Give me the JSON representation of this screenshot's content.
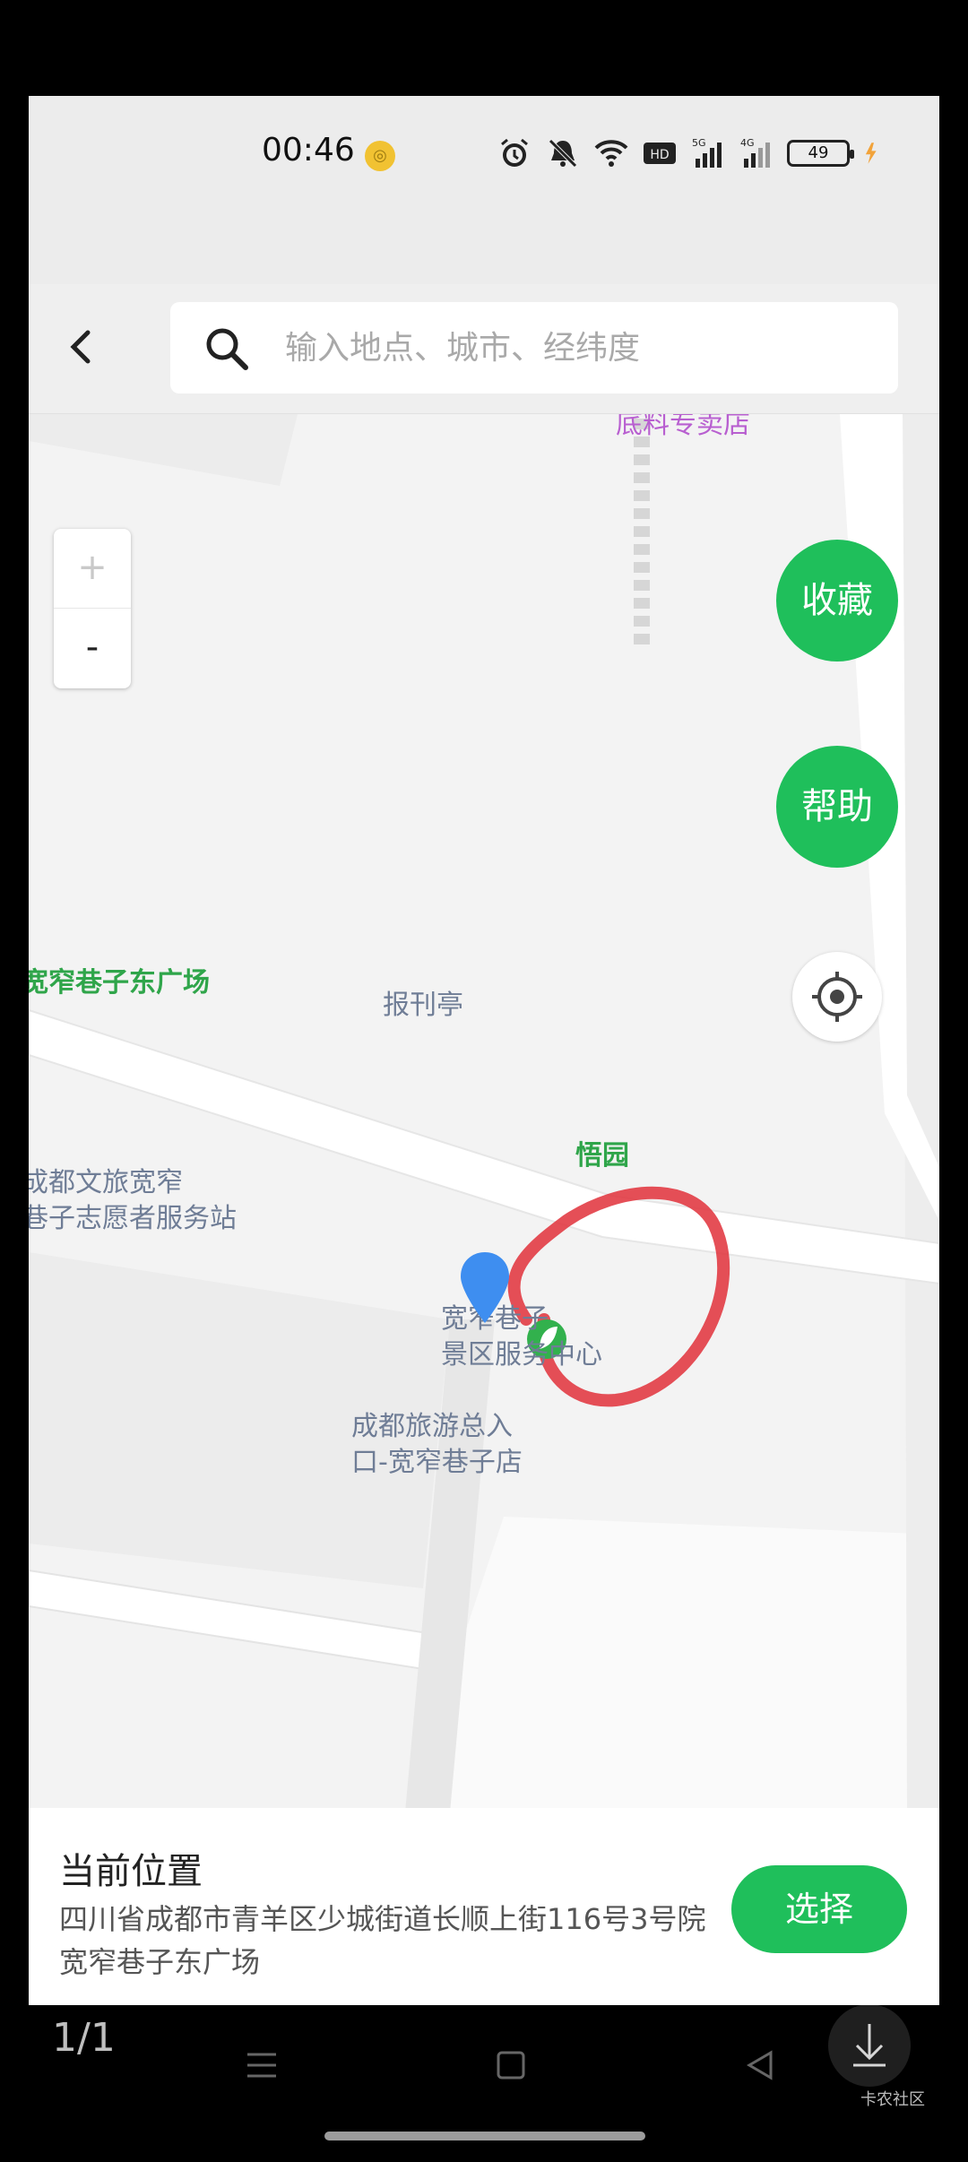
{
  "status_bar": {
    "time": "00:46",
    "battery": "49"
  },
  "search": {
    "placeholder": "输入地点、城市、经纬度"
  },
  "map": {
    "zoom_in_label": "+",
    "zoom_out_label": "-",
    "favorite_label": "收藏",
    "help_label": "帮助",
    "labels": {
      "shop": "底料专卖店",
      "plaza": "宽窄巷子东广场",
      "newsstand": "报刊亭",
      "garden": "悟园",
      "volunteer_line1": "成都文旅宽窄",
      "volunteer_line2": "巷子志愿者服务站",
      "service_line1": "宽窄巷子",
      "service_line2": "景区服务中心",
      "tourism_line1": "成都旅游总入",
      "tourism_line2": "口-宽窄巷子店"
    }
  },
  "bottom_card": {
    "title": "当前位置",
    "address": "四川省成都市青羊区少城街道长顺上街116号3号院宽窄巷子东广场",
    "choose_label": "选择"
  },
  "overlay": {
    "page_count": "1/1",
    "watermark": "卡农社区"
  },
  "colors": {
    "accent_green": "#1fbf5b",
    "annotation_red": "#e0303a"
  }
}
